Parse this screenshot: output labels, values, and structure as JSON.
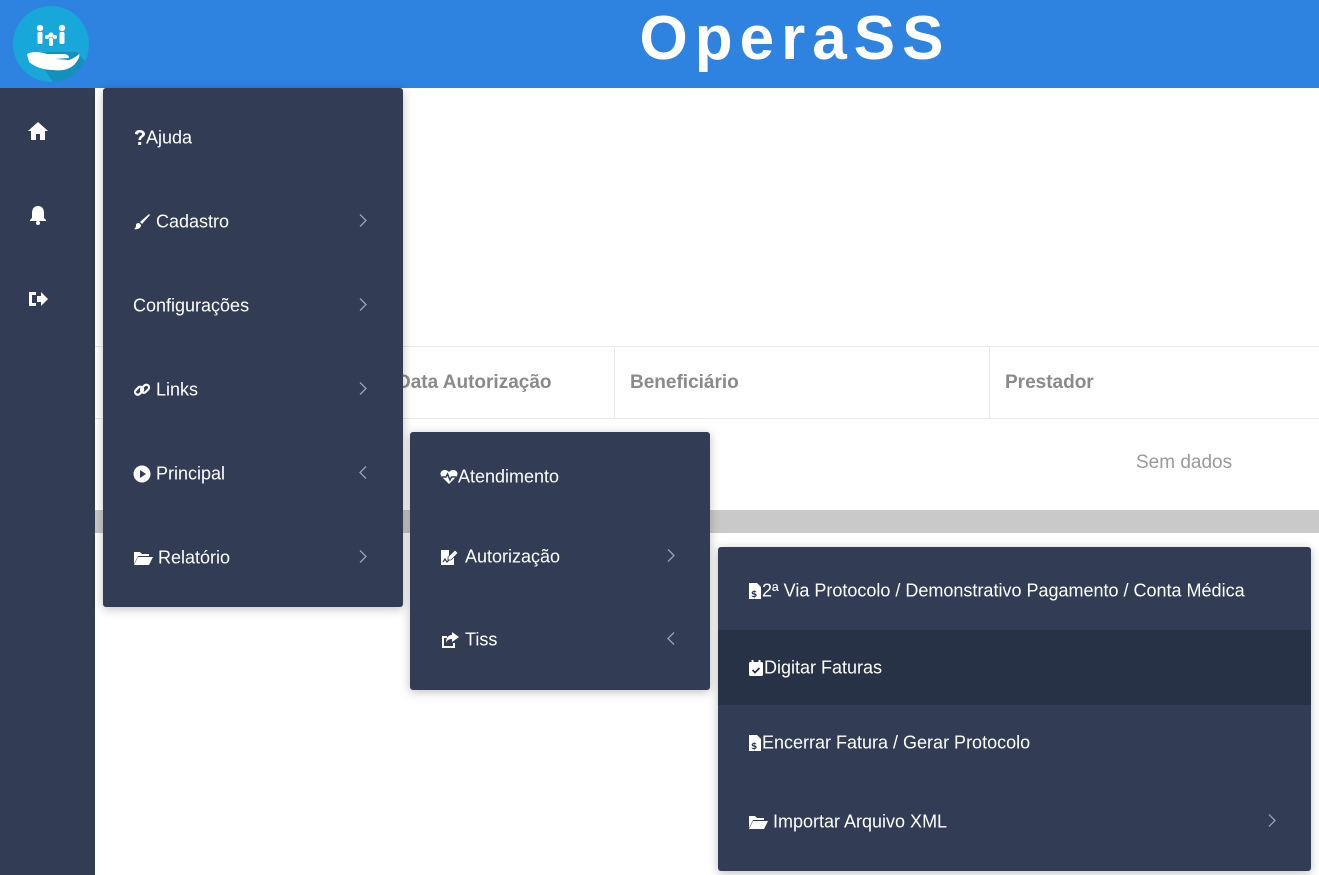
{
  "header": {
    "title": "OperaSS",
    "logo_icon": "family-hand-icon",
    "background": "#2e82e0"
  },
  "sidebar": {
    "icons": [
      "home-icon",
      "bell-icon",
      "sign-out-icon"
    ]
  },
  "table": {
    "columns": [
      "Data Autorização",
      "Beneficiário",
      "Prestador"
    ],
    "empty_text": "Sem dados"
  },
  "menu_main": {
    "items": [
      {
        "label": "Ajuda",
        "icon": "question-icon"
      },
      {
        "label": "Cadastro",
        "icon": "brush-icon",
        "arrow": "right"
      },
      {
        "label": "Configurações",
        "arrow": "right"
      },
      {
        "label": "Links",
        "icon": "link-icon",
        "arrow": "right"
      },
      {
        "label": "Principal",
        "icon": "play-circle-icon",
        "arrow": "left"
      },
      {
        "label": "Relatório",
        "icon": "folder-open-icon",
        "arrow": "right"
      }
    ]
  },
  "menu_principal": {
    "items": [
      {
        "label": "Atendimento",
        "icon": "heartbeat-icon"
      },
      {
        "label": "Autorização",
        "icon": "signature-icon",
        "arrow": "right"
      },
      {
        "label": "Tiss",
        "icon": "share-square-icon",
        "arrow": "left"
      }
    ]
  },
  "menu_tiss": {
    "items": [
      {
        "label": "2ª Via Protocolo / Demonstrativo Pagamento / Conta Médica",
        "icon": "invoice-dollar-icon"
      },
      {
        "label": "Digitar Faturas",
        "icon": "calendar-check-icon",
        "active": true
      },
      {
        "label": "Encerrar Fatura / Gerar Protocolo",
        "icon": "invoice-dollar-icon"
      },
      {
        "label": "Importar Arquivo XML",
        "icon": "folder-open-icon",
        "arrow": "right"
      }
    ]
  },
  "colors": {
    "sidebar": "#323d55",
    "menu": "#323d55",
    "menu_active": "#283247",
    "scrollbar": "#c9c9c9"
  }
}
